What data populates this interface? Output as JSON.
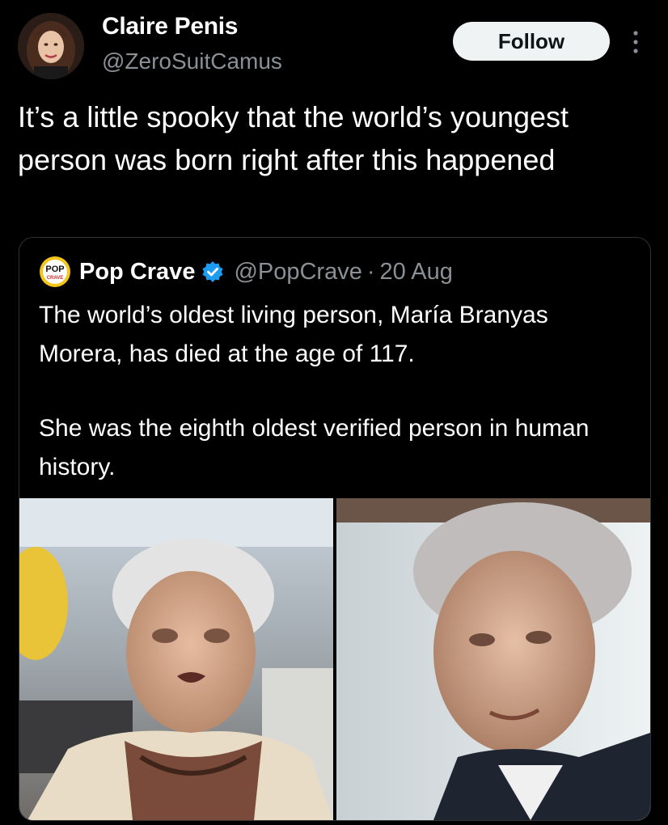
{
  "tweet": {
    "author_name": "Claire Penis",
    "author_handle": "@ZeroSuitCamus",
    "follow_label": "Follow",
    "text": "It’s a little spooky that the world’s youngest person was born right after this happened"
  },
  "quoted_tweet": {
    "author_name": "Pop Crave",
    "author_handle": "@PopCrave",
    "separator": "·",
    "date": "20 Aug",
    "logo_text_top": "POP",
    "logo_text_bottom": "CRAVE",
    "paragraph_1": "The world’s oldest living person, María Branyas Morera, has died at the age of 117.",
    "paragraph_2": "She was the eighth oldest verified person in human history."
  },
  "colors": {
    "background": "#000000",
    "text_primary": "#ffffff",
    "text_secondary": "#8b9096",
    "follow_button_bg": "#eff3f4",
    "verified_blue": "#1d9bf0",
    "card_border": "#2f3336"
  },
  "icons": {
    "more": "more-options-icon",
    "verified": "verified-badge-icon"
  }
}
